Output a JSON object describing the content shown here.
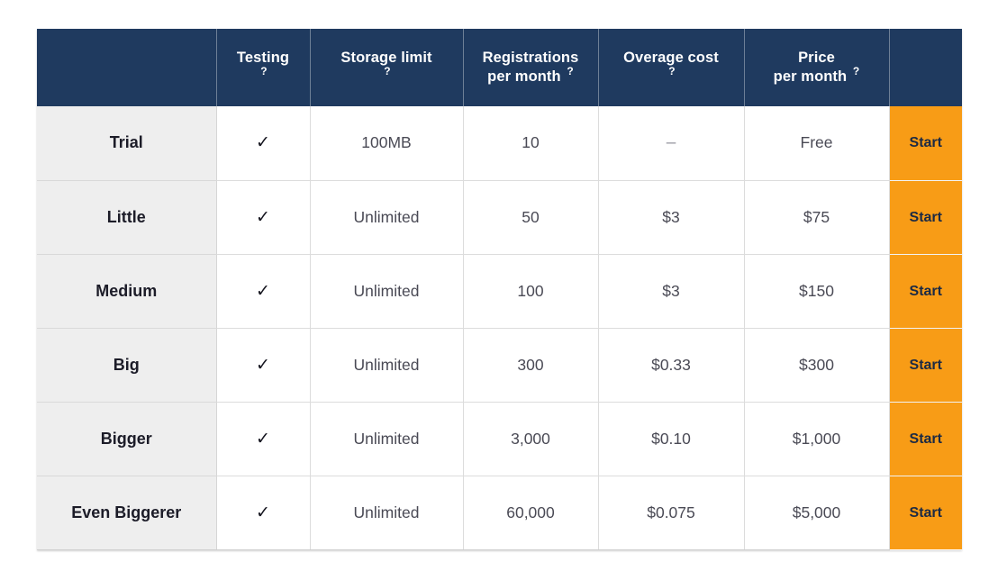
{
  "table": {
    "headers": [
      {
        "lines": [
          ""
        ],
        "help": false,
        "key": "plan"
      },
      {
        "lines": [
          "Testing"
        ],
        "help": true,
        "key": "testing"
      },
      {
        "lines": [
          "Storage limit"
        ],
        "help": true,
        "key": "storage"
      },
      {
        "lines": [
          "Registrations",
          "per month"
        ],
        "help": true,
        "key": "registrations"
      },
      {
        "lines": [
          "Overage cost"
        ],
        "help": true,
        "key": "overage"
      },
      {
        "lines": [
          "Price",
          "per month"
        ],
        "help": true,
        "key": "price"
      },
      {
        "lines": [
          ""
        ],
        "help": false,
        "key": "cta"
      }
    ],
    "help_marker": "?",
    "check_glyph": "✓",
    "cta_label": "Start",
    "colors": {
      "header_bg": "#1f3a5f",
      "header_text": "#ffffff",
      "cta_bg": "#f89c16",
      "cta_text": "#1c2a44",
      "plan_cell_bg": "#eeeeee",
      "cell_text": "#4a4a55",
      "border": "#dcdcdc"
    },
    "rows": [
      {
        "plan": "Trial",
        "testing": "✓",
        "storage": "100MB",
        "registrations": "10",
        "overage": "–",
        "price": "Free",
        "cta": "Start"
      },
      {
        "plan": "Little",
        "testing": "✓",
        "storage": "Unlimited",
        "registrations": "50",
        "overage": "$3",
        "price": "$75",
        "cta": "Start"
      },
      {
        "plan": "Medium",
        "testing": "✓",
        "storage": "Unlimited",
        "registrations": "100",
        "overage": "$3",
        "price": "$150",
        "cta": "Start"
      },
      {
        "plan": "Big",
        "testing": "✓",
        "storage": "Unlimited",
        "registrations": "300",
        "overage": "$0.33",
        "price": "$300",
        "cta": "Start"
      },
      {
        "plan": "Bigger",
        "testing": "✓",
        "storage": "Unlimited",
        "registrations": "3,000",
        "overage": "$0.10",
        "price": "$1,000",
        "cta": "Start"
      },
      {
        "plan": "Even Biggerer",
        "testing": "✓",
        "storage": "Unlimited",
        "registrations": "60,000",
        "overage": "$0.075",
        "price": "$5,000",
        "cta": "Start"
      }
    ]
  }
}
